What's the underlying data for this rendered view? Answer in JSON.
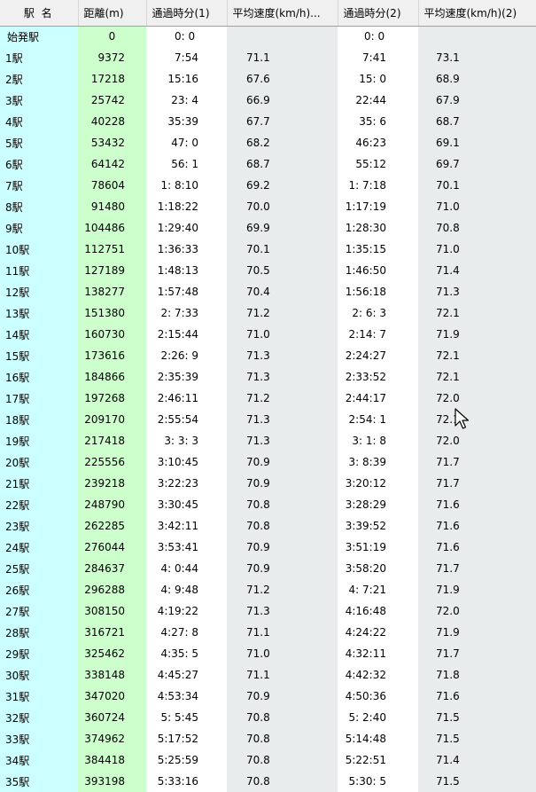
{
  "headers": {
    "name": "駅 名",
    "distance": "距離(m)",
    "time1": "通過時分(1)",
    "speed1": "平均速度(km/h)...",
    "time2": "通過時分(2)",
    "speed2": "平均速度(km/h)(2)"
  },
  "rows": [
    {
      "name": "始発駅",
      "distance": "0",
      "time1": "0: 0",
      "speed1": "",
      "time2": "0: 0",
      "speed2": ""
    },
    {
      "name": "1駅",
      "distance": "9372",
      "time1": "7:54",
      "speed1": "71.1",
      "time2": "7:41",
      "speed2": "73.1"
    },
    {
      "name": "2駅",
      "distance": "17218",
      "time1": "15:16",
      "speed1": "67.6",
      "time2": "15: 0",
      "speed2": "68.9"
    },
    {
      "name": "3駅",
      "distance": "25742",
      "time1": "23: 4",
      "speed1": "66.9",
      "time2": "22:44",
      "speed2": "67.9"
    },
    {
      "name": "4駅",
      "distance": "40228",
      "time1": "35:39",
      "speed1": "67.7",
      "time2": "35: 6",
      "speed2": "68.7"
    },
    {
      "name": "5駅",
      "distance": "53432",
      "time1": "47: 0",
      "speed1": "68.2",
      "time2": "46:23",
      "speed2": "69.1"
    },
    {
      "name": "6駅",
      "distance": "64142",
      "time1": "56: 1",
      "speed1": "68.7",
      "time2": "55:12",
      "speed2": "69.7"
    },
    {
      "name": "7駅",
      "distance": "78604",
      "time1": "1: 8:10",
      "speed1": "69.2",
      "time2": "1: 7:18",
      "speed2": "70.1"
    },
    {
      "name": "8駅",
      "distance": "91480",
      "time1": "1:18:22",
      "speed1": "70.0",
      "time2": "1:17:19",
      "speed2": "71.0"
    },
    {
      "name": "9駅",
      "distance": "104486",
      "time1": "1:29:40",
      "speed1": "69.9",
      "time2": "1:28:30",
      "speed2": "70.8"
    },
    {
      "name": "10駅",
      "distance": "112751",
      "time1": "1:36:33",
      "speed1": "70.1",
      "time2": "1:35:15",
      "speed2": "71.0"
    },
    {
      "name": "11駅",
      "distance": "127189",
      "time1": "1:48:13",
      "speed1": "70.5",
      "time2": "1:46:50",
      "speed2": "71.4"
    },
    {
      "name": "12駅",
      "distance": "138277",
      "time1": "1:57:48",
      "speed1": "70.4",
      "time2": "1:56:18",
      "speed2": "71.3"
    },
    {
      "name": "13駅",
      "distance": "151380",
      "time1": "2: 7:33",
      "speed1": "71.2",
      "time2": "2: 6: 3",
      "speed2": "72.1"
    },
    {
      "name": "14駅",
      "distance": "160730",
      "time1": "2:15:44",
      "speed1": "71.0",
      "time2": "2:14: 7",
      "speed2": "71.9"
    },
    {
      "name": "15駅",
      "distance": "173616",
      "time1": "2:26: 9",
      "speed1": "71.3",
      "time2": "2:24:27",
      "speed2": "72.1"
    },
    {
      "name": "16駅",
      "distance": "184866",
      "time1": "2:35:39",
      "speed1": "71.3",
      "time2": "2:33:52",
      "speed2": "72.1"
    },
    {
      "name": "17駅",
      "distance": "197268",
      "time1": "2:46:11",
      "speed1": "71.2",
      "time2": "2:44:17",
      "speed2": "72.0"
    },
    {
      "name": "18駅",
      "distance": "209170",
      "time1": "2:55:54",
      "speed1": "71.3",
      "time2": "2:54: 1",
      "speed2": "72.1"
    },
    {
      "name": "19駅",
      "distance": "217418",
      "time1": "3: 3: 3",
      "speed1": "71.3",
      "time2": "3: 1: 8",
      "speed2": "72.0"
    },
    {
      "name": "20駅",
      "distance": "225556",
      "time1": "3:10:45",
      "speed1": "70.9",
      "time2": "3: 8:39",
      "speed2": "71.7"
    },
    {
      "name": "21駅",
      "distance": "239218",
      "time1": "3:22:23",
      "speed1": "70.9",
      "time2": "3:20:12",
      "speed2": "71.7"
    },
    {
      "name": "22駅",
      "distance": "248790",
      "time1": "3:30:45",
      "speed1": "70.8",
      "time2": "3:28:29",
      "speed2": "71.6"
    },
    {
      "name": "23駅",
      "distance": "262285",
      "time1": "3:42:11",
      "speed1": "70.8",
      "time2": "3:39:52",
      "speed2": "71.6"
    },
    {
      "name": "24駅",
      "distance": "276044",
      "time1": "3:53:41",
      "speed1": "70.9",
      "time2": "3:51:19",
      "speed2": "71.6"
    },
    {
      "name": "25駅",
      "distance": "284637",
      "time1": "4: 0:44",
      "speed1": "70.9",
      "time2": "3:58:20",
      "speed2": "71.7"
    },
    {
      "name": "26駅",
      "distance": "296288",
      "time1": "4: 9:48",
      "speed1": "71.2",
      "time2": "4: 7:21",
      "speed2": "71.9"
    },
    {
      "name": "27駅",
      "distance": "308150",
      "time1": "4:19:22",
      "speed1": "71.3",
      "time2": "4:16:48",
      "speed2": "72.0"
    },
    {
      "name": "28駅",
      "distance": "316721",
      "time1": "4:27: 8",
      "speed1": "71.1",
      "time2": "4:24:22",
      "speed2": "71.9"
    },
    {
      "name": "29駅",
      "distance": "325462",
      "time1": "4:35: 5",
      "speed1": "71.0",
      "time2": "4:32:11",
      "speed2": "71.7"
    },
    {
      "name": "30駅",
      "distance": "338148",
      "time1": "4:45:27",
      "speed1": "71.1",
      "time2": "4:42:32",
      "speed2": "71.8"
    },
    {
      "name": "31駅",
      "distance": "347020",
      "time1": "4:53:34",
      "speed1": "70.9",
      "time2": "4:50:36",
      "speed2": "71.6"
    },
    {
      "name": "32駅",
      "distance": "360724",
      "time1": "5: 5:45",
      "speed1": "70.8",
      "time2": "5: 2:40",
      "speed2": "71.5"
    },
    {
      "name": "33駅",
      "distance": "374962",
      "time1": "5:17:52",
      "speed1": "70.8",
      "time2": "5:14:48",
      "speed2": "71.5"
    },
    {
      "name": "34駅",
      "distance": "384418",
      "time1": "5:25:59",
      "speed1": "70.8",
      "time2": "5:22:51",
      "speed2": "71.4"
    },
    {
      "name": "35駅",
      "distance": "393198",
      "time1": "5:33:16",
      "speed1": "70.8",
      "time2": "5:30: 5",
      "speed2": "71.5"
    }
  ],
  "colors": {
    "name_col_bg": "#ccffff",
    "distance_col_bg": "#ccffcc",
    "speed_col_bg": "#e8ecec",
    "header_bg": "#f0f0f0"
  },
  "icons": {
    "cursor": "mouse-pointer-icon"
  }
}
